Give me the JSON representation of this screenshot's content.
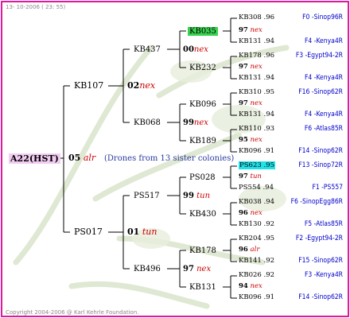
{
  "header": {
    "date": "13- 10-2006 ( 23: 55)"
  },
  "footer": {
    "copyright": "Copyright 2004-2006 @ Karl Kehrle Foundation."
  },
  "colors": {
    "border": "#e01a9a",
    "root_highlight": "#f2cdf2",
    "green_highlight": "#39d14f",
    "cyan_highlight": "#21e2e8",
    "link_blue": "#0000cc",
    "year_red": "#cc0000"
  },
  "root": {
    "name": "A22(HST)",
    "year": "05",
    "suffix": "alr",
    "note": "(Drones from 13 sister colonies)"
  },
  "gen1": [
    {
      "name": "KB107",
      "year": "02",
      "suffix": "nex"
    },
    {
      "name": "PS017",
      "year": "01",
      "suffix": "tun"
    }
  ],
  "gen2": [
    {
      "name": "KB437",
      "year": "00",
      "suffix": "nex"
    },
    {
      "name": "KB068",
      "year": "99",
      "suffix": "nex"
    },
    {
      "name": "PS517",
      "year": "99",
      "suffix": "tun"
    },
    {
      "name": "KB496",
      "year": "97",
      "suffix": "nex"
    }
  ],
  "gen3": [
    {
      "name": "KB035",
      "year": "97",
      "suffix": "nex"
    },
    {
      "name": "KB232",
      "year": "97",
      "suffix": "nex"
    },
    {
      "name": "KB096",
      "year": "97",
      "suffix": "nex"
    },
    {
      "name": "KB189",
      "year": "95",
      "suffix": "nex"
    },
    {
      "name": "PS028",
      "year": "97",
      "suffix": "tun"
    },
    {
      "name": "KB430",
      "year": "96",
      "suffix": "nex"
    },
    {
      "name": "KB178",
      "year": "96",
      "suffix": "alr"
    },
    {
      "name": "KB131",
      "year": "94",
      "suffix": "nex"
    }
  ],
  "gen4": [
    {
      "name": "KB308",
      "year": ".96",
      "origin": "F0 -Sinop96R"
    },
    {
      "name": "KB131",
      "year": ".94",
      "origin": "F4 -Kenya4R"
    },
    {
      "name": "KB178",
      "year": ".96",
      "origin": "F3 -Egypt94-2R"
    },
    {
      "name": "KB131",
      "year": ".94",
      "origin": "F4 -Kenya4R"
    },
    {
      "name": "KB310",
      "year": ".95",
      "origin": "F16 -Sinop62R"
    },
    {
      "name": "KB131",
      "year": ".94",
      "origin": "F4 -Kenya4R"
    },
    {
      "name": "KB110",
      "year": ".93",
      "origin": "F6 -Atlas85R"
    },
    {
      "name": "KB096",
      "year": ".91",
      "origin": "F14 -Sinop62R"
    },
    {
      "name": "PS623",
      "year": ".95",
      "origin": "F13 -Sinop72R"
    },
    {
      "name": "PS554",
      "year": ".94",
      "origin": "F1 -PS557"
    },
    {
      "name": "KB038",
      "year": ".94",
      "origin": "F6 -SinopEgg86R"
    },
    {
      "name": "KB130",
      "year": ".92",
      "origin": "F5 -Atlas85R"
    },
    {
      "name": "KB204",
      "year": ".95",
      "origin": "F2 -Egypt94-2R"
    },
    {
      "name": "KB141",
      "year": ".92",
      "origin": "F15 -Sinop62R"
    },
    {
      "name": "KB026",
      "year": ".92",
      "origin": "F3 -Kenya4R"
    },
    {
      "name": "KB096",
      "year": ".91",
      "origin": "F14 -Sinop62R"
    }
  ]
}
